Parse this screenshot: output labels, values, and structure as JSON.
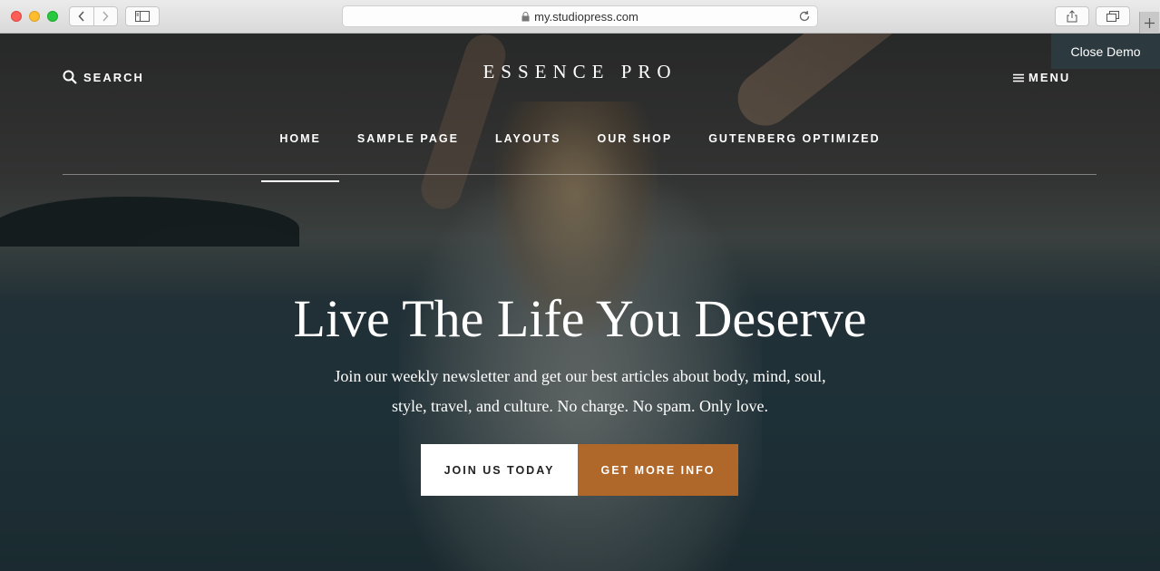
{
  "browser": {
    "url": "my.studiopress.com"
  },
  "demo_bar": {
    "close_label": "Close Demo"
  },
  "header": {
    "search_label": "SEARCH",
    "site_title": "ESSENCE PRO",
    "menu_label": "MENU"
  },
  "nav": {
    "items": [
      {
        "label": "HOME",
        "active": true
      },
      {
        "label": "SAMPLE PAGE",
        "active": false
      },
      {
        "label": "LAYOUTS",
        "active": false
      },
      {
        "label": "OUR SHOP",
        "active": false
      },
      {
        "label": "GUTENBERG OPTIMIZED",
        "active": false
      }
    ]
  },
  "hero": {
    "title": "Live The Life You Deserve",
    "text_line1": "Join our weekly newsletter and get our best articles about body, mind, soul,",
    "text_line2": "style, travel, and culture. No charge. No spam. Only love.",
    "primary_button": "JOIN US TODAY",
    "secondary_button": "GET MORE INFO"
  },
  "colors": {
    "accent": "#b0672a",
    "primary_button_bg": "#ffffff",
    "close_demo_bg": "#2c3a40"
  },
  "icons": [
    "back-icon",
    "forward-icon",
    "sidebar-icon",
    "lock-icon",
    "reload-icon",
    "share-icon",
    "tabs-icon",
    "plus-icon",
    "search-icon",
    "hamburger-icon"
  ]
}
